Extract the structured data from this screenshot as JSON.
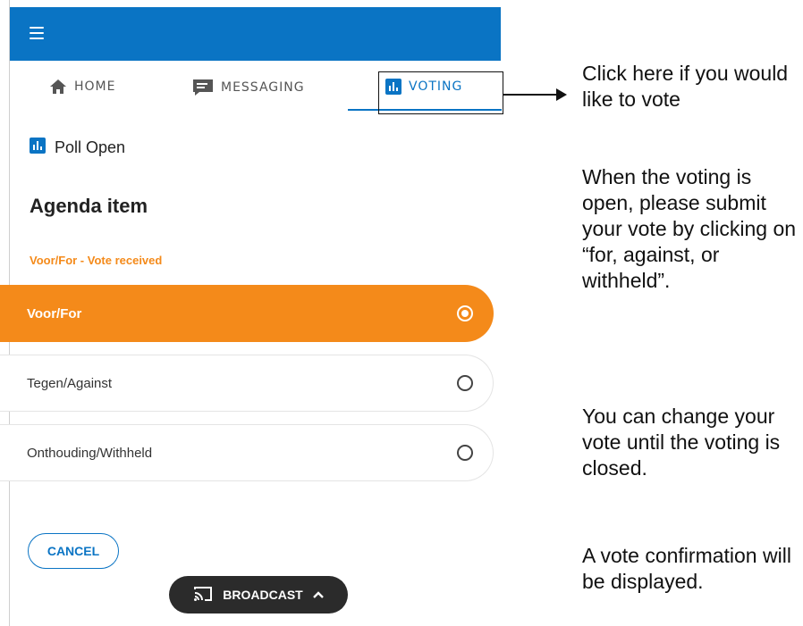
{
  "tabs": [
    {
      "label": "HOME",
      "icon": "home-icon"
    },
    {
      "label": "MESSAGING",
      "icon": "chat-icon"
    },
    {
      "label": "VOTING",
      "icon": "poll-icon"
    }
  ],
  "active_tab": "VOTING",
  "poll": {
    "status": "Poll Open",
    "agenda_title": "Agenda item",
    "vote_status": "Voor/For - Vote received"
  },
  "options": [
    {
      "label": "Voor/For",
      "selected": true
    },
    {
      "label": "Tegen/Against",
      "selected": false
    },
    {
      "label": "Onthouding/Withheld",
      "selected": false
    }
  ],
  "buttons": {
    "cancel": "CANCEL",
    "broadcast": "BROADCAST"
  },
  "annotations": {
    "click_here": "Click here if you would like to vote",
    "when_open": "When the voting is open, please submit your vote by clicking on “for, against, or withheld”.",
    "change_vote": "You can change your vote until the voting is closed.",
    "confirmation": "A vote confirmation will be displayed."
  },
  "colors": {
    "primary": "#0a74c4",
    "accent": "#f48a1a",
    "broadcast_bg": "#2b2b2b"
  }
}
